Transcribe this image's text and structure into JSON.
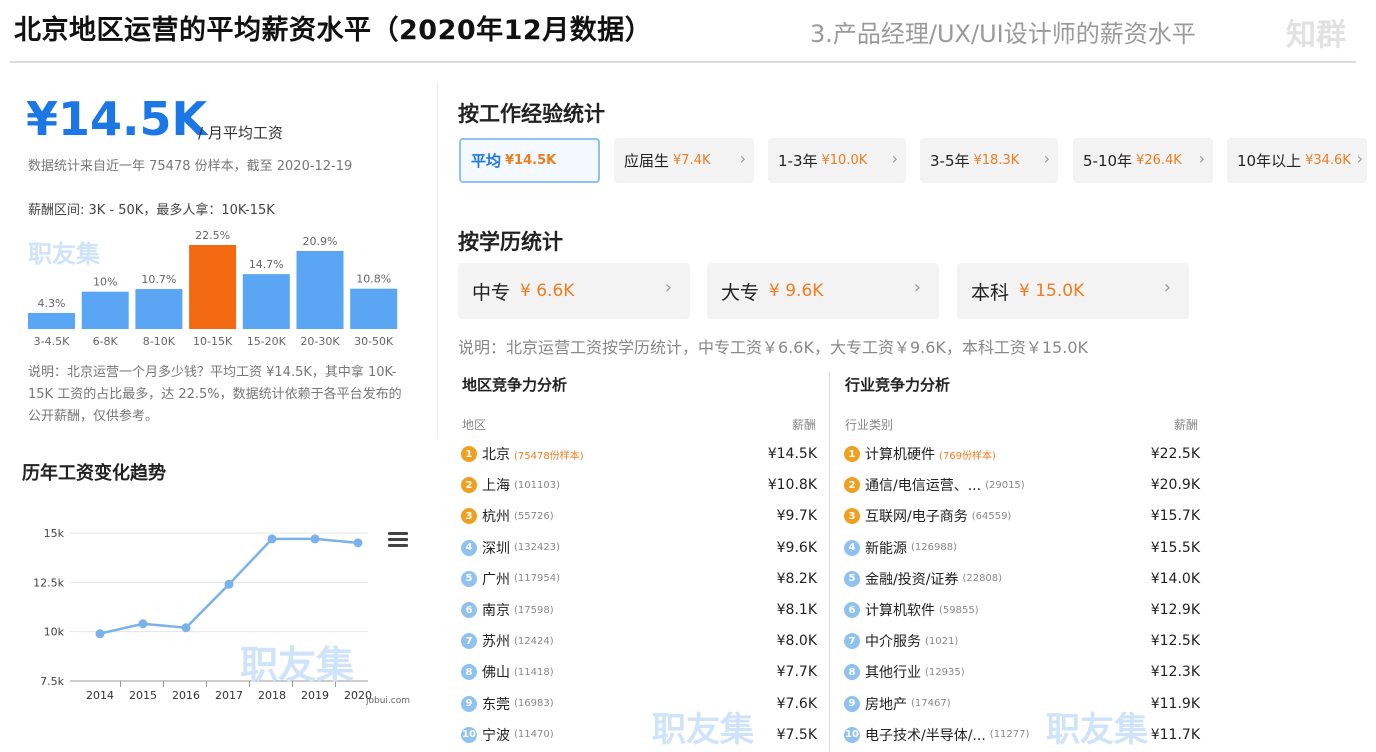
{
  "header": {
    "title": "北京地区运营的平均薪资水平（2020年12月数据）",
    "subtitle": "3.产品经理/UX/UI设计师的薪资水平",
    "brand": "知群"
  },
  "summary": {
    "avg_salary": "¥14.5K",
    "avg_unit": "/ 月平均工资",
    "stat_note": "数据统计来自近一年 75478 份样本，截至 2020-12-19",
    "range_line": "薪酬区间: 3K - 50K，最多人拿：10K-15K",
    "explain": "说明：北京运营一个月多少钱？平均工资 ¥14.5K，其中拿 10K-15K 工资的占比最多，达 22.5%，数据统计依赖于各平台发布的公开薪酬，仅供参考。"
  },
  "watermarks": {
    "w1": "职友集",
    "w2": "职友集",
    "w3": "职友集",
    "w4": "职友集"
  },
  "histogram": {
    "chart_data": {
      "type": "bar",
      "categories": [
        "3-4.5K",
        "6-8K",
        "8-10K",
        "10-15K",
        "15-20K",
        "20-30K",
        "30-50K"
      ],
      "values": [
        4.3,
        10,
        10.7,
        22.5,
        14.7,
        20.9,
        10.8
      ],
      "labels": [
        "4.3%",
        "10%",
        "10.7%",
        "22.5%",
        "14.7%",
        "20.9%",
        "10.8%"
      ],
      "highlight_index": 3,
      "colors": {
        "normal": "#5aa6f5",
        "highlight": "#f36a12"
      }
    }
  },
  "trend": {
    "title": "历年工资变化趋势",
    "source": "jobui.com",
    "chart_data": {
      "type": "line",
      "x": [
        "2014",
        "2015",
        "2016",
        "2017",
        "2018",
        "2019",
        "2020"
      ],
      "values": [
        9.9,
        10.4,
        10.2,
        12.4,
        14.7,
        14.7,
        14.5
      ],
      "yticks": [
        "7.5k",
        "10k",
        "12.5k",
        "15k"
      ],
      "ytick_values": [
        7.5,
        10,
        12.5,
        15
      ],
      "ylim": [
        7.5,
        15
      ],
      "color": "#7ab3ea"
    }
  },
  "experience": {
    "title": "按工作经验统计",
    "tabs": [
      {
        "label": "平均",
        "value": "¥14.5K"
      },
      {
        "label": "应届生",
        "value": "¥7.4K"
      },
      {
        "label": "1-3年",
        "value": "¥10.0K"
      },
      {
        "label": "3-5年",
        "value": "¥18.3K"
      },
      {
        "label": "5-10年",
        "value": "¥26.4K"
      },
      {
        "label": "10年以上",
        "value": "¥34.6K"
      }
    ]
  },
  "education": {
    "title": "按学历统计",
    "cards": [
      {
        "label": "中专",
        "value": "¥ 6.6K"
      },
      {
        "label": "大专",
        "value": "¥ 9.6K"
      },
      {
        "label": "本科",
        "value": "¥ 15.0K"
      }
    ],
    "note": "说明：北京运营工资按学历统计，中专工资￥6.6K，大专工资￥9.6K，本科工资￥15.0K"
  },
  "region": {
    "title": "地区竞争力分析",
    "col_name": "地区",
    "col_salary": "薪酬",
    "rows": [
      {
        "rank": "1",
        "name": "北京",
        "count": "(75478份样本)",
        "salary": "¥14.5K"
      },
      {
        "rank": "2",
        "name": "上海",
        "count": "(101103)",
        "salary": "¥10.8K"
      },
      {
        "rank": "3",
        "name": "杭州",
        "count": "(55726)",
        "salary": "¥9.7K"
      },
      {
        "rank": "4",
        "name": "深圳",
        "count": "(132423)",
        "salary": "¥9.6K"
      },
      {
        "rank": "5",
        "name": "广州",
        "count": "(117954)",
        "salary": "¥8.2K"
      },
      {
        "rank": "6",
        "name": "南京",
        "count": "(17598)",
        "salary": "¥8.1K"
      },
      {
        "rank": "7",
        "name": "苏州",
        "count": "(12424)",
        "salary": "¥8.0K"
      },
      {
        "rank": "8",
        "name": "佛山",
        "count": "(11418)",
        "salary": "¥7.7K"
      },
      {
        "rank": "9",
        "name": "东莞",
        "count": "(16983)",
        "salary": "¥7.6K"
      },
      {
        "rank": "10",
        "name": "宁波",
        "count": "(11470)",
        "salary": "¥7.5K"
      }
    ]
  },
  "industry": {
    "title": "行业竞争力分析",
    "col_name": "行业类别",
    "col_salary": "薪酬",
    "rows": [
      {
        "rank": "1",
        "name": "计算机硬件",
        "count": "(769份样本)",
        "salary": "¥22.5K"
      },
      {
        "rank": "2",
        "name": "通信/电信运营、...",
        "count": "(29015)",
        "salary": "¥20.9K"
      },
      {
        "rank": "3",
        "name": "互联网/电子商务",
        "count": "(64559)",
        "salary": "¥15.7K"
      },
      {
        "rank": "4",
        "name": "新能源",
        "count": "(126988)",
        "salary": "¥15.5K"
      },
      {
        "rank": "5",
        "name": "金融/投资/证券",
        "count": "(22808)",
        "salary": "¥14.0K"
      },
      {
        "rank": "6",
        "name": "计算机软件",
        "count": "(59855)",
        "salary": "¥12.9K"
      },
      {
        "rank": "7",
        "name": "中介服务",
        "count": "(1021)",
        "salary": "¥12.5K"
      },
      {
        "rank": "8",
        "name": "其他行业",
        "count": "(12935)",
        "salary": "¥12.3K"
      },
      {
        "rank": "9",
        "name": "房地产",
        "count": "(17467)",
        "salary": "¥11.9K"
      },
      {
        "rank": "10",
        "name": "电子技术/半导体/...",
        "count": "(11277)",
        "salary": "¥11.7K"
      }
    ]
  },
  "icons": {
    "chevron": "chevron-right-icon",
    "menu": "hamburger-menu-icon"
  },
  "glyphs": {
    "chevron": "›"
  }
}
